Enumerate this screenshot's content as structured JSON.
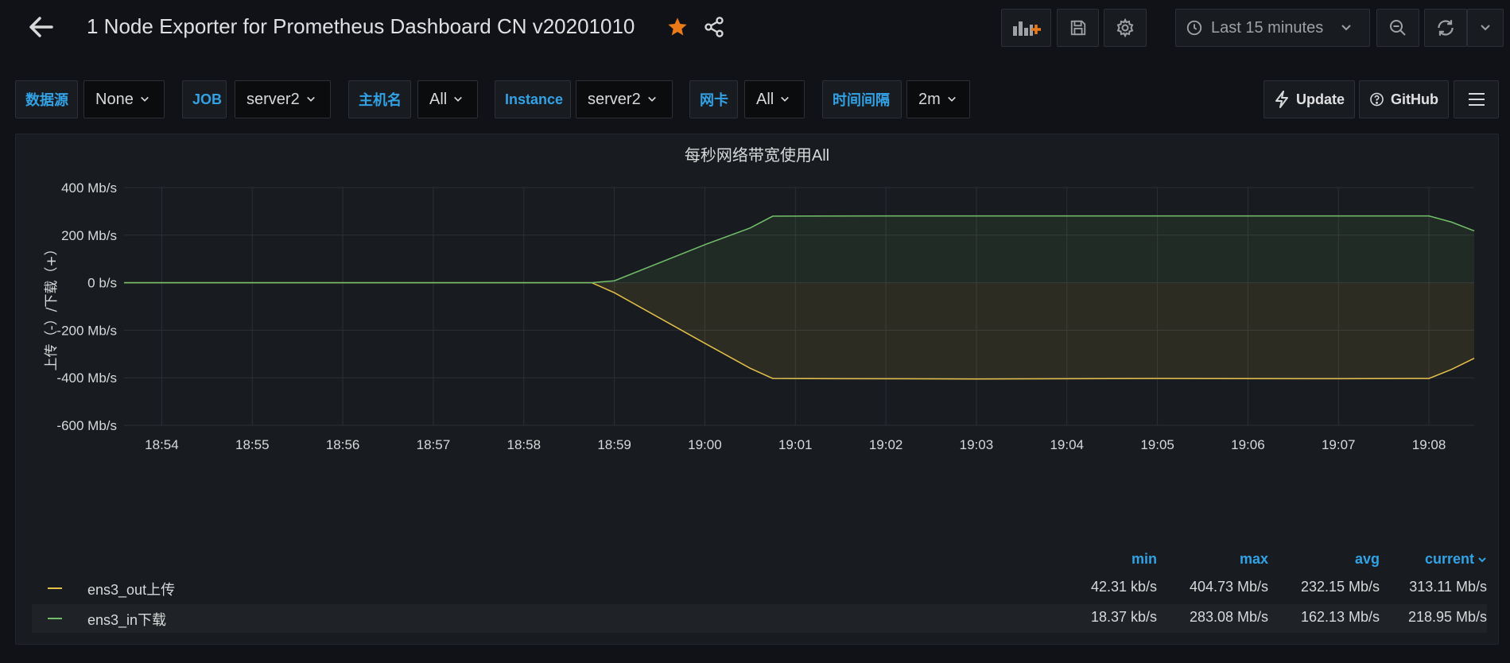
{
  "header": {
    "title": "1 Node Exporter for Prometheus Dashboard CN v20201010",
    "time_range": "Last 15 minutes"
  },
  "colors": {
    "accent": "#33a2e5",
    "star": "#eb7b18",
    "series_out": "#e5c14a",
    "series_in": "#73bf69"
  },
  "variables": {
    "datasource_label": "数据源",
    "datasource_value": "None",
    "job_label": "JOB",
    "job_value": "server2",
    "hostname_label": "主机名",
    "hostname_value": "All",
    "instance_label": "Instance",
    "instance_value": "server2",
    "nic_label": "网卡",
    "nic_value": "All",
    "interval_label": "时间间隔",
    "interval_value": "2m"
  },
  "links": {
    "update": "Update",
    "github": "GitHub"
  },
  "panel": {
    "title": "每秒网络带宽使用All",
    "legend": {
      "headers": [
        "min",
        "max",
        "avg",
        "current"
      ],
      "rows": [
        {
          "name": "ens3_out上传",
          "min": "42.31 kb/s",
          "max": "404.73 Mb/s",
          "avg": "232.15 Mb/s",
          "current": "313.11 Mb/s"
        },
        {
          "name": "ens3_in下载",
          "min": "18.37 kb/s",
          "max": "283.08 Mb/s",
          "avg": "162.13 Mb/s",
          "current": "218.95 Mb/s"
        }
      ]
    }
  },
  "chart_data": {
    "type": "area",
    "title": "每秒网络带宽使用All",
    "ylabel": "上传（-）/下载（+）",
    "ylim": [
      -600,
      400
    ],
    "yticks": [
      "400 Mb/s",
      "200 Mb/s",
      "0 b/s",
      "-200 Mb/s",
      "-400 Mb/s",
      "-600 Mb/s"
    ],
    "ytick_values": [
      400,
      200,
      0,
      -200,
      -400,
      -600
    ],
    "xticks": [
      "18:54",
      "18:55",
      "18:56",
      "18:57",
      "18:58",
      "18:59",
      "19:00",
      "19:01",
      "19:02",
      "19:03",
      "19:04",
      "19:05",
      "19:06",
      "19:07",
      "19:08"
    ],
    "grid": true,
    "series": [
      {
        "name": "ens3_out上传",
        "points": [
          [
            "18:53:35",
            0
          ],
          [
            "18:58:45",
            0
          ],
          [
            "18:59:00",
            -42
          ],
          [
            "19:00:00",
            -255
          ],
          [
            "19:00:30",
            -360
          ],
          [
            "19:00:45",
            -403
          ],
          [
            "19:01:30",
            -404
          ],
          [
            "19:03:00",
            -405
          ],
          [
            "19:05:00",
            -403
          ],
          [
            "19:07:00",
            -404
          ],
          [
            "19:08:00",
            -403
          ],
          [
            "19:08:15",
            -365
          ],
          [
            "19:08:30",
            -318
          ]
        ]
      },
      {
        "name": "ens3_in下载",
        "points": [
          [
            "18:53:35",
            0
          ],
          [
            "18:58:45",
            0
          ],
          [
            "18:59:00",
            8
          ],
          [
            "19:00:00",
            160
          ],
          [
            "19:00:30",
            230
          ],
          [
            "19:00:45",
            280
          ],
          [
            "19:02:00",
            281
          ],
          [
            "19:04:00",
            281
          ],
          [
            "19:06:00",
            281
          ],
          [
            "19:08:00",
            281
          ],
          [
            "19:08:15",
            255
          ],
          [
            "19:08:30",
            218
          ]
        ]
      }
    ]
  }
}
